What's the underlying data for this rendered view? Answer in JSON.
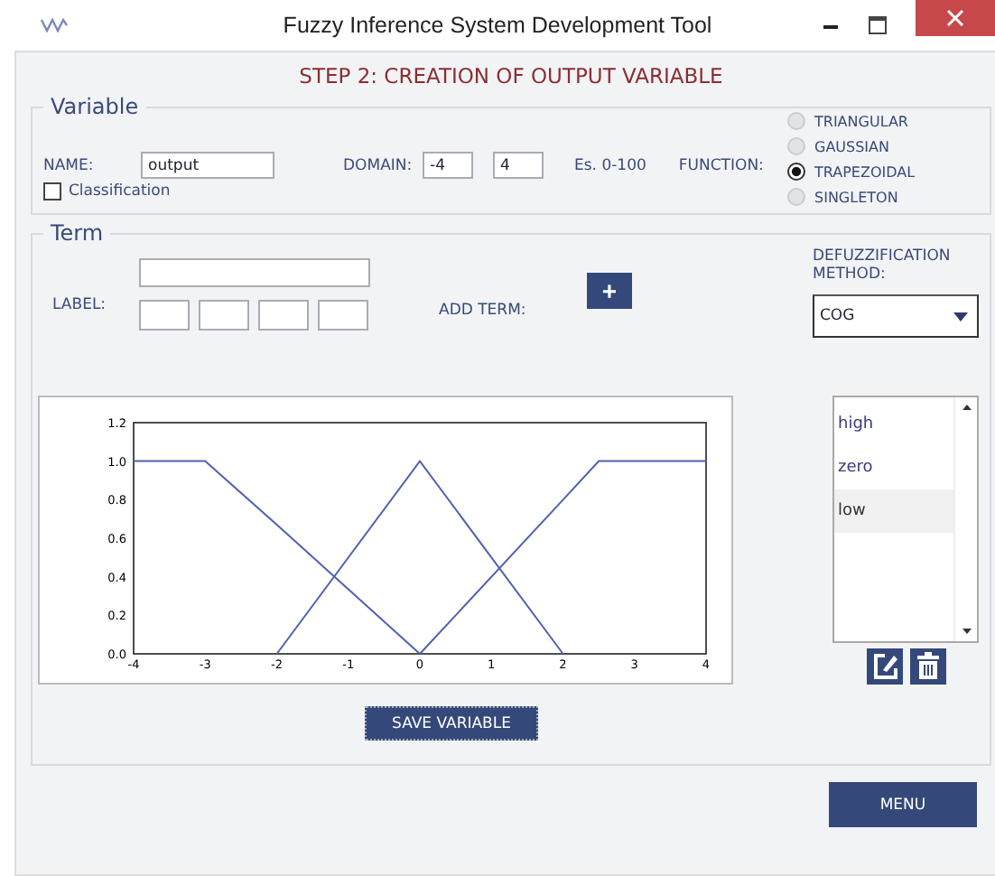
{
  "window": {
    "title": "Fuzzy Inference System Development Tool"
  },
  "heading": "STEP 2: CREATION OF OUTPUT VARIABLE",
  "variable": {
    "legend": "Variable",
    "name_label": "NAME:",
    "name_value": "output",
    "domain_label": "DOMAIN:",
    "domain_min": "-4",
    "domain_max": "4",
    "domain_hint": "Es. 0-100",
    "function_label": "FUNCTION:",
    "functions": [
      {
        "label": "TRIANGULAR",
        "selected": false
      },
      {
        "label": "GAUSSIAN",
        "selected": false
      },
      {
        "label": "TRAPEZOIDAL",
        "selected": true
      },
      {
        "label": "SINGLETON",
        "selected": false
      }
    ],
    "classification": {
      "label": "Classification",
      "checked": false
    }
  },
  "term": {
    "legend": "Term",
    "label_label": "LABEL:",
    "add_term_label": "ADD TERM:",
    "add_button": "+",
    "defuzz_label": "DEFUZZIFICATION METHOD:",
    "defuzz_value": "COG"
  },
  "chart_data": {
    "type": "line",
    "x": [
      -4,
      -3,
      -2,
      0,
      2,
      2.5,
      4
    ],
    "xlim": [
      -4,
      4
    ],
    "ylim": [
      0,
      1.2
    ],
    "xticks": [
      -4,
      -3,
      -2,
      -1,
      0,
      1,
      2,
      3,
      4
    ],
    "yticks": [
      {
        "value": 0,
        "label": "0.0"
      },
      {
        "value": 0.2,
        "label": "0.2"
      },
      {
        "value": 0.4,
        "label": "0.4"
      },
      {
        "value": 0.6,
        "label": "0.6"
      },
      {
        "value": 0.8,
        "label": "0.8"
      },
      {
        "value": 1,
        "label": "1.0"
      },
      {
        "value": 1.2,
        "label": "1.2"
      }
    ],
    "series": [
      {
        "color": "#5060b0",
        "values": [
          1,
          1,
          0.67,
          0,
          null,
          null,
          null
        ]
      },
      {
        "color": "#5060b0",
        "values": [
          null,
          null,
          0,
          1,
          0,
          null,
          null
        ]
      },
      {
        "color": "#5060b0",
        "values": [
          null,
          null,
          null,
          0,
          0.8,
          1,
          1
        ]
      }
    ]
  },
  "terms": [
    {
      "label": "high",
      "selected": false
    },
    {
      "label": "zero",
      "selected": false
    },
    {
      "label": "low",
      "selected": true
    }
  ],
  "save_button": "SAVE VARIABLE",
  "menu_button": "MENU"
}
